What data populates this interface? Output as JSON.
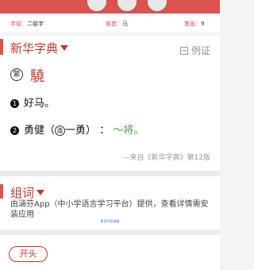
{
  "meta": {
    "level_label": "字级：",
    "level_value": "二级字",
    "radical_label": "部首：",
    "radical_value": "马",
    "strokes_label": "笔画：",
    "strokes_value": "9"
  },
  "dict": {
    "title": "新华字典",
    "example_label": "例证",
    "trad_mark": "繁",
    "trad_char": "驍",
    "definitions": [
      {
        "num": "1",
        "text": "好马。"
      },
      {
        "num": "2",
        "pre": "勇健",
        "tag": "连",
        "mid": "一勇",
        "colon": "：",
        "green": "～将。"
      }
    ],
    "source": "—来自《新华字典》第12版"
  },
  "words": {
    "title": "组词",
    "description": "由涵芬App（中小学语言学习平台）提供，查看详情需安装应用",
    "more_label": "更多内容请看",
    "items": [
      "开头"
    ]
  },
  "colors": {
    "accent": "#d9534f",
    "title_red": "#c0392b",
    "green_text": "#4a9a4a"
  }
}
